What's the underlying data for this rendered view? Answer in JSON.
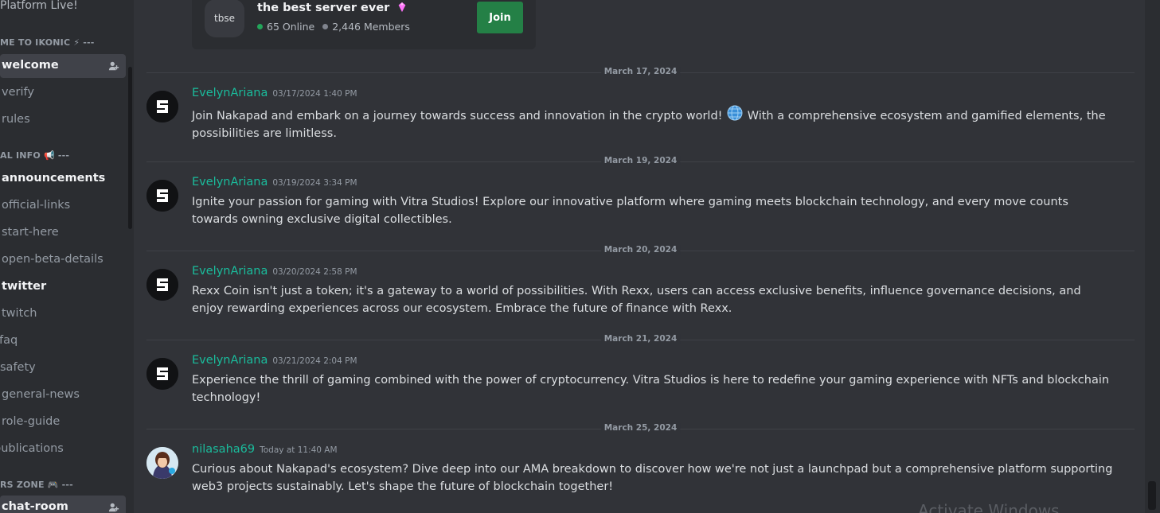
{
  "sidebar": {
    "top_text": "Platform Live!",
    "categories": [
      {
        "label": "ME TO IKONIC",
        "emoji": "⚡",
        "suffix": "---"
      },
      {
        "label": "AL INFO",
        "emoji": "📢",
        "suffix": "---"
      },
      {
        "label": "RS ZONE",
        "emoji": "🎮",
        "suffix": "---"
      }
    ],
    "channels": [
      {
        "label": "welcome"
      },
      {
        "label": "verify"
      },
      {
        "label": "rules"
      },
      {
        "label": "announcements"
      },
      {
        "label": "official-links"
      },
      {
        "label": "start-here"
      },
      {
        "label": "open-beta-details"
      },
      {
        "label": "twitter"
      },
      {
        "label": "twitch"
      },
      {
        "label": "faq"
      },
      {
        "label": "safety"
      },
      {
        "label": "general-news"
      },
      {
        "label": "role-guide"
      },
      {
        "label": "publications"
      },
      {
        "label": "chat-room"
      }
    ]
  },
  "invite": {
    "icon_text": "tbse",
    "server_name": "the best server ever",
    "online": "65 Online",
    "members": "2,446 Members",
    "join_label": "Join"
  },
  "dividers": [
    "March 17, 2024",
    "March 19, 2024",
    "March 20, 2024",
    "March 21, 2024",
    "March 25, 2024"
  ],
  "messages": [
    {
      "author": "EvelynAriana",
      "timestamp": "03/17/2024 1:40 PM",
      "text_a": "Join Nakapad and embark on a journey towards success and innovation in the crypto world!",
      "text_b": "With a comprehensive ecosystem and gamified elements, the possibilities are limitless."
    },
    {
      "author": "EvelynAriana",
      "timestamp": "03/19/2024 3:34 PM",
      "text": "Ignite your passion for gaming with Vitra Studios! Explore our innovative platform where gaming meets blockchain technology, and every move counts towards owning exclusive digital collectibles."
    },
    {
      "author": "EvelynAriana",
      "timestamp": "03/20/2024 2:58 PM",
      "text": "Rexx Coin isn't just a token; it's a gateway to a world of possibilities. With Rexx, users can access exclusive benefits, influence governance decisions, and enjoy rewarding experiences across our ecosystem. Embrace the future of finance with Rexx."
    },
    {
      "author": "EvelynAriana",
      "timestamp": "03/21/2024 2:04 PM",
      "text": "Experience the thrill of gaming combined with the power of cryptocurrency. Vitra Studios is here to redefine your gaming experience with NFTs and blockchain technology!"
    },
    {
      "author": "nilasaha69",
      "timestamp": "Today at 11:40 AM",
      "text": "Curious about Nakapad's ecosystem? Dive deep into our AMA breakdown to discover how we're not just a launchpad but a comprehensive platform supporting web3 projects sustainably. Let's shape the future of blockchain together!"
    }
  ],
  "watermark": "Activate Windows",
  "colors": {
    "background": "#313338",
    "sidebar": "#2b2d31",
    "author_green": "#1abc9c",
    "join_green": "#248046",
    "online_green": "#23a55a"
  }
}
